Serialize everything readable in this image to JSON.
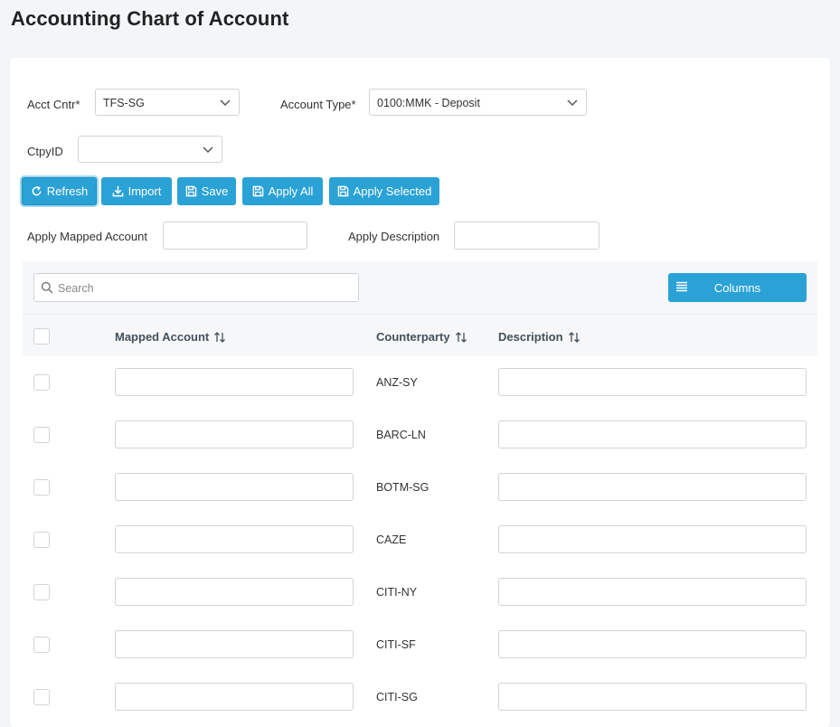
{
  "page": {
    "title": "Accounting Chart of Account"
  },
  "filters": {
    "acct_cntr_label": "Acct Cntr*",
    "acct_cntr_value": "TFS-SG",
    "account_type_label": "Account Type*",
    "account_type_value": "0100:MMK - Deposit",
    "ctpy_label": "CtpyID",
    "ctpy_value": ""
  },
  "toolbar": {
    "refresh": "Refresh",
    "import": "Import",
    "save": "Save",
    "apply_all": "Apply All",
    "apply_selected": "Apply Selected"
  },
  "apply": {
    "mapped_account_label": "Apply Mapped Account",
    "description_label": "Apply Description"
  },
  "grid": {
    "search_placeholder": "Search",
    "columns_button": "Columns",
    "headers": [
      "Mapped Account",
      "Counterparty",
      "Description"
    ],
    "rows": [
      {
        "counterparty": "ANZ-SY"
      },
      {
        "counterparty": "BARC-LN"
      },
      {
        "counterparty": "BOTM-SG"
      },
      {
        "counterparty": "CAZE"
      },
      {
        "counterparty": "CITI-NY"
      },
      {
        "counterparty": "CITI-SF"
      },
      {
        "counterparty": "CITI-SG"
      }
    ]
  },
  "colors": {
    "accent": "#2aa2d6",
    "background": "#f3f6f9"
  }
}
